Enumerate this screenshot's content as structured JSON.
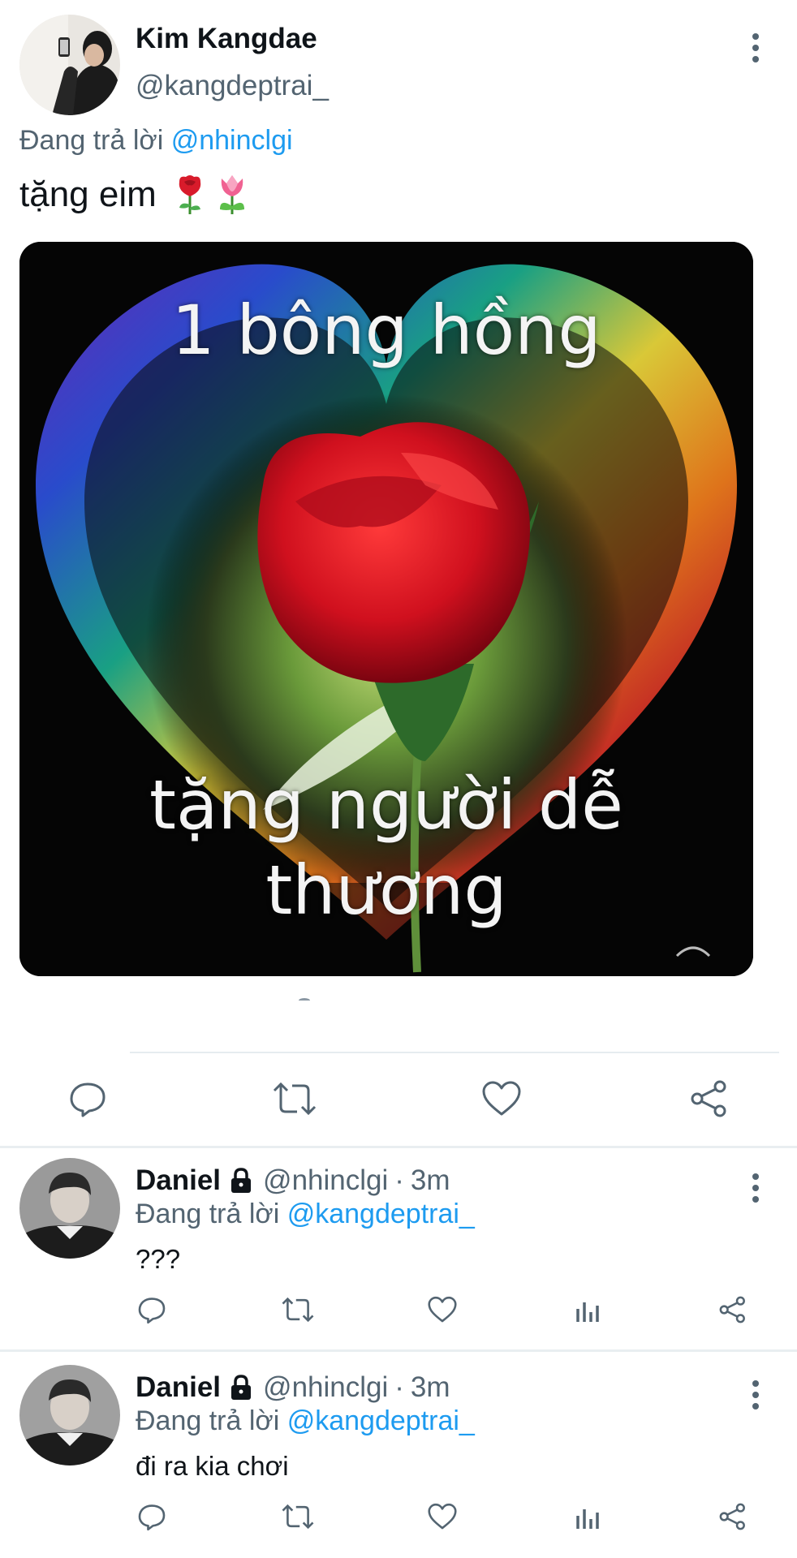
{
  "main_tweet": {
    "author_name": "Kim Kangdae",
    "author_handle": "@kangdeptrai_",
    "replying_prefix": "Đang trả lời",
    "replying_to": "@nhinclgi",
    "text": "tặng eim",
    "emojis": [
      "rose-icon",
      "tulip-icon"
    ],
    "media": {
      "caption_line1": "1 bông hồng",
      "caption_line2": "tặng người dễ",
      "caption_line3": "thương"
    },
    "actions": [
      "reply-icon",
      "retweet-icon",
      "like-icon",
      "share-icon"
    ]
  },
  "replies": [
    {
      "name": "Daniel",
      "handle": "@nhinclgi",
      "dot": "·",
      "time": "3m",
      "replying_prefix": "Đang trả lời",
      "replying_to": "@kangdeptrai_",
      "text": "???"
    },
    {
      "name": "Daniel",
      "handle": "@nhinclgi",
      "dot": "·",
      "time": "3m",
      "replying_prefix": "Đang trả lời",
      "replying_to": "@kangdeptrai_",
      "text": "đi ra kia chơi"
    }
  ],
  "reply_actions": [
    "reply-icon",
    "retweet-icon",
    "like-icon",
    "analytics-icon",
    "share-icon"
  ],
  "colors": {
    "text_primary": "#0f1419",
    "text_secondary": "#536471",
    "link": "#1d9bf0",
    "divider": "#e6ecf0"
  }
}
